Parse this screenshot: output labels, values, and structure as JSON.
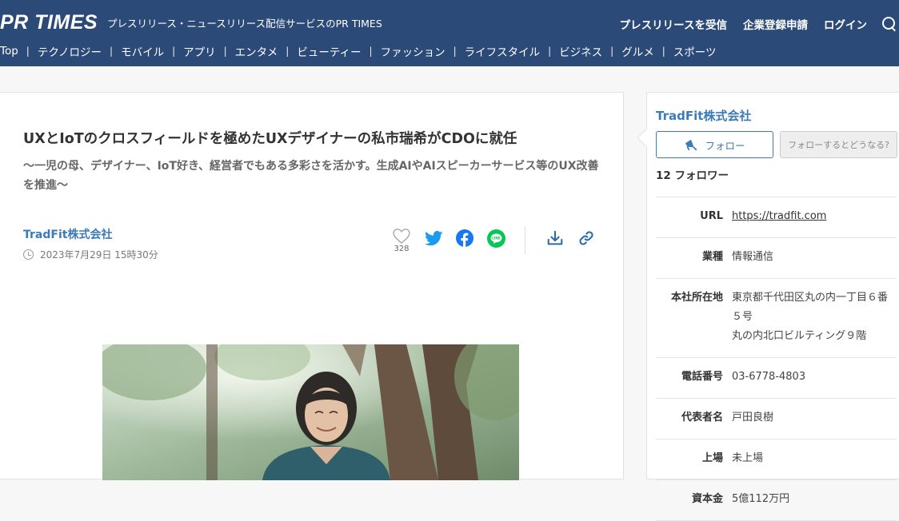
{
  "header": {
    "logo": "PR TIMES",
    "tagline": "プレスリリース・ニュースリリース配信サービスのPR TIMES",
    "links": [
      "プレスリリースを受信",
      "企業登録申請",
      "ログイン"
    ],
    "search_icon": "search-icon"
  },
  "nav": {
    "items": [
      "Top",
      "テクノロジー",
      "モバイル",
      "アプリ",
      "エンタメ",
      "ビューティー",
      "ファッション",
      "ライフスタイル",
      "ビジネス",
      "グルメ",
      "スポーツ"
    ]
  },
  "article": {
    "title": "UXとIoTのクロスフィールドを極めたUXデザイナーの私市瑞希がCDOに就任",
    "subtitle": "〜一児の母、デザイナー、IoT好き、経営者でもある多彩さを活かす。生成AIやAIスピーカーサービス等のUX改善を推進〜",
    "company": "TradFit株式会社",
    "date": "2023年7月29日 15時30分",
    "like_count": "328",
    "share_icons": [
      "heart-icon",
      "twitter-icon",
      "facebook-icon",
      "line-icon",
      "download-icon",
      "link-icon"
    ]
  },
  "sidebar": {
    "company": "TradFit株式会社",
    "follow_label": "フォロー",
    "follow_help": "フォローするとどうなる?",
    "followers": "12 フォロワー",
    "info": [
      {
        "label": "URL",
        "value": "https://tradfit.com"
      },
      {
        "label": "業種",
        "value": "情報通信"
      },
      {
        "label": "本社所在地",
        "value": "東京都千代田区丸の内一丁目６番５号",
        "value2": "丸の内北口ビルティング９階"
      },
      {
        "label": "電話番号",
        "value": "03-6778-4803"
      },
      {
        "label": "代表者名",
        "value": "戸田良樹"
      },
      {
        "label": "上場",
        "value": "未上場"
      },
      {
        "label": "資本金",
        "value": "5億112万円"
      }
    ]
  },
  "colors": {
    "header_bg": "#2b4a78",
    "link_blue": "#3b7bb8",
    "twitter": "#1d9bf0",
    "facebook": "#1877f2",
    "line": "#06c755"
  }
}
